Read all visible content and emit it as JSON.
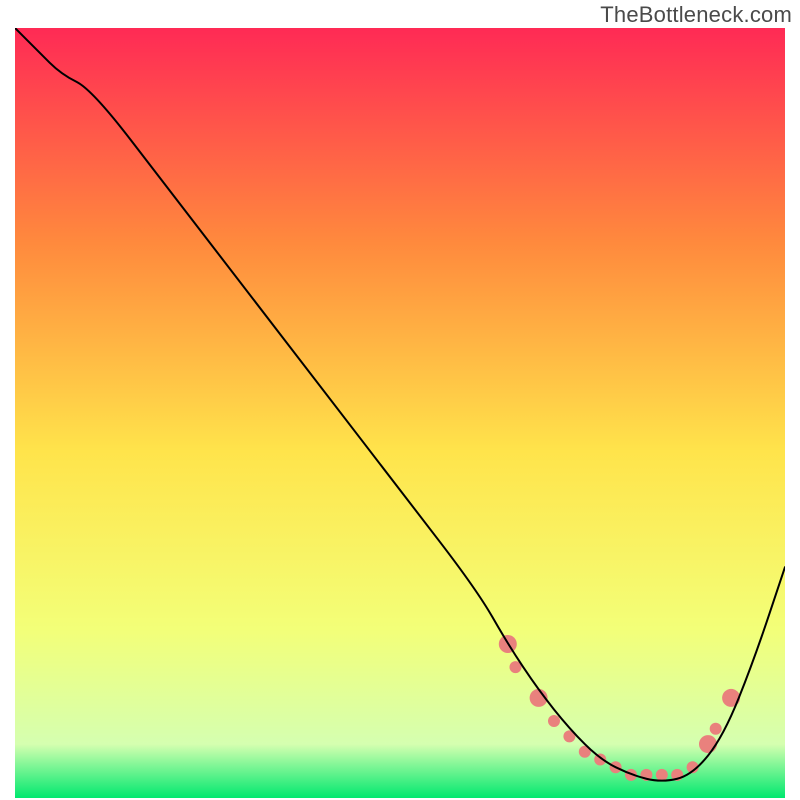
{
  "watermark": "TheBottleneck.com",
  "chart_data": {
    "type": "line",
    "title": "",
    "xlabel": "",
    "ylabel": "",
    "xlim": [
      0,
      100
    ],
    "ylim": [
      0,
      100
    ],
    "grid": false,
    "axes_visible": false,
    "gradient_colors": {
      "top": "#ff2a55",
      "upper_mid": "#ff8a3d",
      "mid": "#ffe44b",
      "lower_mid": "#f3ff78",
      "near_bottom": "#d5ffb0",
      "bottom": "#00e86f"
    },
    "series": [
      {
        "name": "bottleneck_curve",
        "color": "#000000",
        "stroke_width": 2,
        "x": [
          0,
          3,
          6,
          10,
          20,
          30,
          40,
          50,
          60,
          64,
          68,
          72,
          76,
          80,
          84,
          88,
          92,
          96,
          100
        ],
        "y": [
          100,
          97,
          94,
          92,
          79,
          66,
          53,
          40,
          27,
          20,
          14,
          9,
          5,
          3,
          2,
          3,
          8,
          18,
          30
        ]
      }
    ],
    "markers": {
      "name": "highlight_dots",
      "color": "#e9817d",
      "radius_main": 7,
      "radius_mid": 5,
      "points": [
        {
          "x": 64,
          "y": 20,
          "r": 9
        },
        {
          "x": 65,
          "y": 17,
          "r": 6
        },
        {
          "x": 68,
          "y": 13,
          "r": 9
        },
        {
          "x": 70,
          "y": 10,
          "r": 6
        },
        {
          "x": 72,
          "y": 8,
          "r": 6
        },
        {
          "x": 74,
          "y": 6,
          "r": 6
        },
        {
          "x": 76,
          "y": 5,
          "r": 6
        },
        {
          "x": 78,
          "y": 4,
          "r": 6
        },
        {
          "x": 80,
          "y": 3,
          "r": 6
        },
        {
          "x": 82,
          "y": 3,
          "r": 6
        },
        {
          "x": 84,
          "y": 3,
          "r": 6
        },
        {
          "x": 86,
          "y": 3,
          "r": 6
        },
        {
          "x": 88,
          "y": 4,
          "r": 6
        },
        {
          "x": 90,
          "y": 7,
          "r": 9
        },
        {
          "x": 91,
          "y": 9,
          "r": 6
        },
        {
          "x": 93,
          "y": 13,
          "r": 9
        }
      ]
    }
  }
}
